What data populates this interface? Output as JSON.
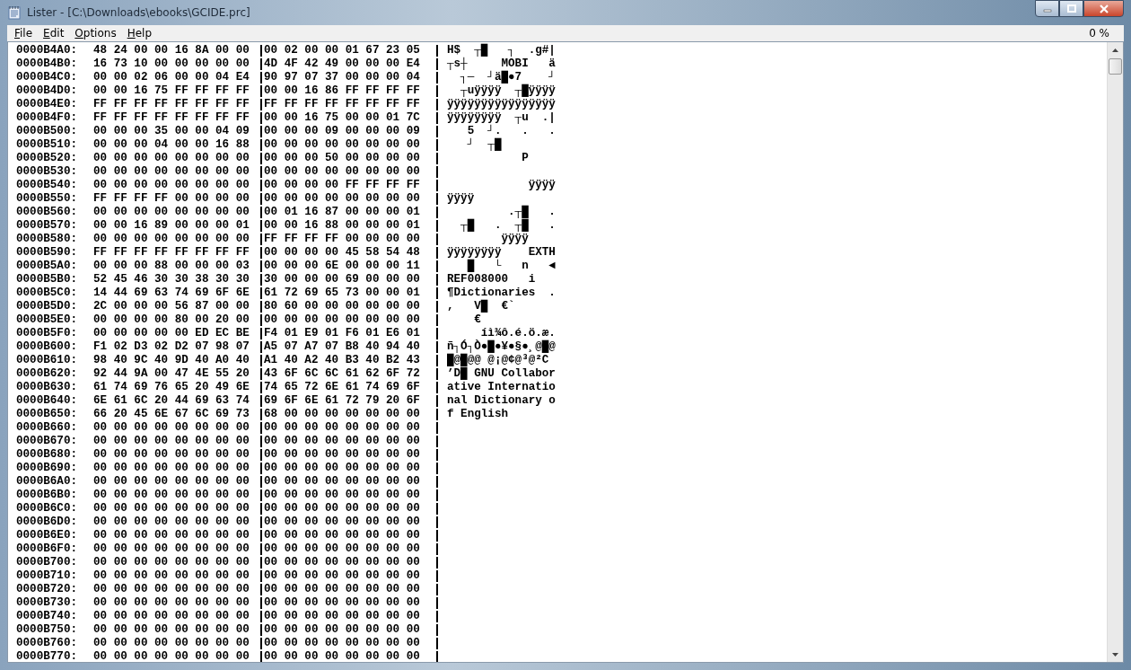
{
  "window": {
    "title": "Lister - [C:\\Downloads\\ebooks\\GCIDE.prc]"
  },
  "menu": [
    {
      "key": "F",
      "rest": "ile"
    },
    {
      "key": "E",
      "rest": "dit"
    },
    {
      "key": "O",
      "rest": "ptions"
    },
    {
      "key": "H",
      "rest": "elp"
    }
  ],
  "percent": "0 %",
  "rows": [
    {
      "offset": "0000B4A0:",
      "left": "48 24 00 00 16 8A 00 00",
      "right": "00 02 00 00 01 67 23 05",
      "ascii": "H$  ┬█   ┐  .g#|"
    },
    {
      "offset": "0000B4B0:",
      "left": "16 73 10 00 00 00 00 00",
      "right": "4D 4F 42 49 00 00 00 E4",
      "ascii": "┬s┼     MOBI   ä"
    },
    {
      "offset": "0000B4C0:",
      "left": "00 00 02 06 00 00 04 E4",
      "right": "90 97 07 37 00 00 00 04",
      "ascii": "  ┐─  ┘ä█●7    ┘"
    },
    {
      "offset": "0000B4D0:",
      "left": "00 00 16 75 FF FF FF FF",
      "right": "00 00 16 86 FF FF FF FF",
      "ascii": "  ┬uÿÿÿÿ  ┬█ÿÿÿÿ"
    },
    {
      "offset": "0000B4E0:",
      "left": "FF FF FF FF FF FF FF FF",
      "right": "FF FF FF FF FF FF FF FF",
      "ascii": "ÿÿÿÿÿÿÿÿÿÿÿÿÿÿÿÿ"
    },
    {
      "offset": "0000B4F0:",
      "left": "FF FF FF FF FF FF FF FF",
      "right": "00 00 16 75 00 00 01 7C",
      "ascii": "ÿÿÿÿÿÿÿÿ  ┬u  .|"
    },
    {
      "offset": "0000B500:",
      "left": "00 00 00 35 00 00 04 09",
      "right": "00 00 00 09 00 00 00 09",
      "ascii": "   5  ┘.   .   ."
    },
    {
      "offset": "0000B510:",
      "left": "00 00 00 04 00 00 16 88",
      "right": "00 00 00 00 00 00 00 00",
      "ascii": "   ┘  ┬█"
    },
    {
      "offset": "0000B520:",
      "left": "00 00 00 00 00 00 00 00",
      "right": "00 00 00 50 00 00 00 00",
      "ascii": "           P"
    },
    {
      "offset": "0000B530:",
      "left": "00 00 00 00 00 00 00 00",
      "right": "00 00 00 00 00 00 00 00",
      "ascii": ""
    },
    {
      "offset": "0000B540:",
      "left": "00 00 00 00 00 00 00 00",
      "right": "00 00 00 00 FF FF FF FF",
      "ascii": "            ÿÿÿÿ"
    },
    {
      "offset": "0000B550:",
      "left": "FF FF FF FF 00 00 00 00",
      "right": "00 00 00 00 00 00 00 00",
      "ascii": "ÿÿÿÿ"
    },
    {
      "offset": "0000B560:",
      "left": "00 00 00 00 00 00 00 00",
      "right": "00 01 16 87 00 00 00 01",
      "ascii": "         .┬█   ."
    },
    {
      "offset": "0000B570:",
      "left": "00 00 16 89 00 00 00 01",
      "right": "00 00 16 88 00 00 00 01",
      "ascii": "  ┬█   .  ┬█   ."
    },
    {
      "offset": "0000B580:",
      "left": "00 00 00 00 00 00 00 00",
      "right": "FF FF FF FF 00 00 00 00",
      "ascii": "        ÿÿÿÿ"
    },
    {
      "offset": "0000B590:",
      "left": "FF FF FF FF FF FF FF FF",
      "right": "00 00 00 00 45 58 54 48",
      "ascii": "ÿÿÿÿÿÿÿÿ    EXTH"
    },
    {
      "offset": "0000B5A0:",
      "left": "00 00 00 88 00 00 00 03",
      "right": "00 00 00 6E 00 00 00 11",
      "ascii": "   █   └   n   ◄"
    },
    {
      "offset": "0000B5B0:",
      "left": "52 45 46 30 30 38 30 30",
      "right": "30 00 00 00 69 00 00 00",
      "ascii": "REF008000   i"
    },
    {
      "offset": "0000B5C0:",
      "left": "14 44 69 63 74 69 6F 6E",
      "right": "61 72 69 65 73 00 00 01",
      "ascii": "¶Dictionaries  ."
    },
    {
      "offset": "0000B5D0:",
      "left": "2C 00 00 00 56 87 00 00",
      "right": "80 60 00 00 00 00 00 00",
      "ascii": ",   V█  €`"
    },
    {
      "offset": "0000B5E0:",
      "left": "00 00 00 00 80 00 20 00",
      "right": "00 00 00 00 00 00 00 00",
      "ascii": "    €"
    },
    {
      "offset": "0000B5F0:",
      "left": "00 00 00 00 00 ED EC BE",
      "right": "F4 01 E9 01 F6 01 E6 01",
      "ascii": "     íì¾ô.é.ö.æ."
    },
    {
      "offset": "0000B600:",
      "left": "F1 02 D3 02 D2 07 98 07",
      "right": "A5 07 A7 07 B8 40 94 40",
      "ascii": "ñ┐Ó┐Ò●█●¥●§●¸@█@"
    },
    {
      "offset": "0000B610:",
      "left": "98 40 9C 40 9D 40 A0 40",
      "right": "A1 40 A2 40 B3 40 B2 43",
      "ascii": "█@█@@ @¡@¢@³@²C"
    },
    {
      "offset": "0000B620:",
      "left": "92 44 9A 00 47 4E 55 20",
      "right": "43 6F 6C 6C 61 62 6F 72",
      "ascii": "’D█ GNU Collabor"
    },
    {
      "offset": "0000B630:",
      "left": "61 74 69 76 65 20 49 6E",
      "right": "74 65 72 6E 61 74 69 6F",
      "ascii": "ative Internatio"
    },
    {
      "offset": "0000B640:",
      "left": "6E 61 6C 20 44 69 63 74",
      "right": "69 6F 6E 61 72 79 20 6F",
      "ascii": "nal Dictionary o"
    },
    {
      "offset": "0000B650:",
      "left": "66 20 45 6E 67 6C 69 73",
      "right": "68 00 00 00 00 00 00 00",
      "ascii": "f English"
    },
    {
      "offset": "0000B660:",
      "left": "00 00 00 00 00 00 00 00",
      "right": "00 00 00 00 00 00 00 00",
      "ascii": ""
    },
    {
      "offset": "0000B670:",
      "left": "00 00 00 00 00 00 00 00",
      "right": "00 00 00 00 00 00 00 00",
      "ascii": ""
    },
    {
      "offset": "0000B680:",
      "left": "00 00 00 00 00 00 00 00",
      "right": "00 00 00 00 00 00 00 00",
      "ascii": ""
    },
    {
      "offset": "0000B690:",
      "left": "00 00 00 00 00 00 00 00",
      "right": "00 00 00 00 00 00 00 00",
      "ascii": ""
    },
    {
      "offset": "0000B6A0:",
      "left": "00 00 00 00 00 00 00 00",
      "right": "00 00 00 00 00 00 00 00",
      "ascii": ""
    },
    {
      "offset": "0000B6B0:",
      "left": "00 00 00 00 00 00 00 00",
      "right": "00 00 00 00 00 00 00 00",
      "ascii": ""
    },
    {
      "offset": "0000B6C0:",
      "left": "00 00 00 00 00 00 00 00",
      "right": "00 00 00 00 00 00 00 00",
      "ascii": ""
    },
    {
      "offset": "0000B6D0:",
      "left": "00 00 00 00 00 00 00 00",
      "right": "00 00 00 00 00 00 00 00",
      "ascii": ""
    },
    {
      "offset": "0000B6E0:",
      "left": "00 00 00 00 00 00 00 00",
      "right": "00 00 00 00 00 00 00 00",
      "ascii": ""
    },
    {
      "offset": "0000B6F0:",
      "left": "00 00 00 00 00 00 00 00",
      "right": "00 00 00 00 00 00 00 00",
      "ascii": ""
    },
    {
      "offset": "0000B700:",
      "left": "00 00 00 00 00 00 00 00",
      "right": "00 00 00 00 00 00 00 00",
      "ascii": ""
    },
    {
      "offset": "0000B710:",
      "left": "00 00 00 00 00 00 00 00",
      "right": "00 00 00 00 00 00 00 00",
      "ascii": ""
    },
    {
      "offset": "0000B720:",
      "left": "00 00 00 00 00 00 00 00",
      "right": "00 00 00 00 00 00 00 00",
      "ascii": ""
    },
    {
      "offset": "0000B730:",
      "left": "00 00 00 00 00 00 00 00",
      "right": "00 00 00 00 00 00 00 00",
      "ascii": ""
    },
    {
      "offset": "0000B740:",
      "left": "00 00 00 00 00 00 00 00",
      "right": "00 00 00 00 00 00 00 00",
      "ascii": ""
    },
    {
      "offset": "0000B750:",
      "left": "00 00 00 00 00 00 00 00",
      "right": "00 00 00 00 00 00 00 00",
      "ascii": ""
    },
    {
      "offset": "0000B760:",
      "left": "00 00 00 00 00 00 00 00",
      "right": "00 00 00 00 00 00 00 00",
      "ascii": ""
    },
    {
      "offset": "0000B770:",
      "left": "00 00 00 00 00 00 00 00",
      "right": "00 00 00 00 00 00 00 00",
      "ascii": ""
    }
  ]
}
